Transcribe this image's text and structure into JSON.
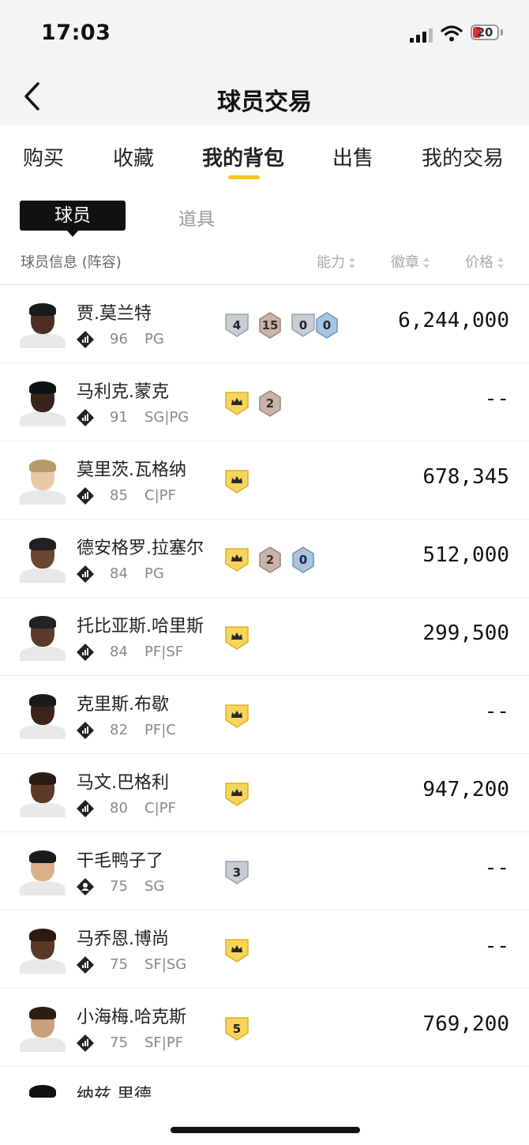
{
  "status": {
    "time": "17:03",
    "battery": "20"
  },
  "header": {
    "title": "球员交易"
  },
  "tabs": [
    {
      "label": "购买",
      "active": false
    },
    {
      "label": "收藏",
      "active": false
    },
    {
      "label": "我的背包",
      "active": true
    },
    {
      "label": "出售",
      "active": false
    },
    {
      "label": "我的交易",
      "active": false
    }
  ],
  "segments": {
    "active": "球员",
    "inactive": "道具"
  },
  "columns": {
    "info": "球员信息 (阵容)",
    "ability": "能力",
    "badge": "徽章",
    "price": "价格"
  },
  "players": [
    {
      "name": "贾.莫兰特",
      "rating": "96",
      "pos": "PG",
      "price": "6,244,000",
      "meta_icon": "bars-icon",
      "badges": [
        {
          "type": "silver",
          "text": "4"
        },
        {
          "type": "bronze",
          "text": "15"
        },
        {
          "type": "silver",
          "text": "0"
        },
        {
          "type": "blue",
          "text": "0"
        }
      ]
    },
    {
      "name": "马利克.蒙克",
      "rating": "91",
      "pos": "SG|PG",
      "price": "--",
      "meta_icon": "bars-icon",
      "badges": [
        {
          "type": "gold-crown",
          "text": ""
        },
        {
          "type": "bronze",
          "text": "2"
        }
      ]
    },
    {
      "name": "莫里茨.瓦格纳",
      "rating": "85",
      "pos": "C|PF",
      "price": "678,345",
      "meta_icon": "bars-icon",
      "badges": [
        {
          "type": "gold-crown",
          "text": ""
        }
      ]
    },
    {
      "name": "德安格罗.拉塞尔",
      "rating": "84",
      "pos": "PG",
      "price": "512,000",
      "meta_icon": "bars-icon",
      "badges": [
        {
          "type": "gold-crown",
          "text": ""
        },
        {
          "type": "bronze",
          "text": "2"
        },
        {
          "type": "blue",
          "text": "0"
        }
      ]
    },
    {
      "name": "托比亚斯.哈里斯",
      "rating": "84",
      "pos": "PF|SF",
      "price": "299,500",
      "meta_icon": "bars-icon",
      "badges": [
        {
          "type": "gold-crown",
          "text": ""
        }
      ]
    },
    {
      "name": "克里斯.布歇",
      "rating": "82",
      "pos": "PF|C",
      "price": "--",
      "meta_icon": "bars-icon",
      "badges": [
        {
          "type": "gold-crown",
          "text": ""
        }
      ]
    },
    {
      "name": "马文.巴格利",
      "rating": "80",
      "pos": "C|PF",
      "price": "947,200",
      "meta_icon": "bars-icon",
      "badges": [
        {
          "type": "gold-crown",
          "text": ""
        }
      ]
    },
    {
      "name": "干毛鸭子了",
      "rating": "75",
      "pos": "SG",
      "price": "--",
      "meta_icon": "person-icon",
      "badges": [
        {
          "type": "silver",
          "text": "3"
        }
      ]
    },
    {
      "name": "马乔恩.博尚",
      "rating": "75",
      "pos": "SF|SG",
      "price": "--",
      "meta_icon": "bars-icon",
      "badges": [
        {
          "type": "gold-crown",
          "text": ""
        }
      ]
    },
    {
      "name": "小海梅.哈克斯",
      "rating": "75",
      "pos": "SF|PF",
      "price": "769,200",
      "meta_icon": "bars-icon",
      "badges": [
        {
          "type": "gold",
          "text": "5"
        }
      ]
    },
    {
      "name": "纳兹.里德",
      "rating": "",
      "pos": "",
      "price": "",
      "meta_icon": "bars-icon",
      "badges": []
    }
  ]
}
